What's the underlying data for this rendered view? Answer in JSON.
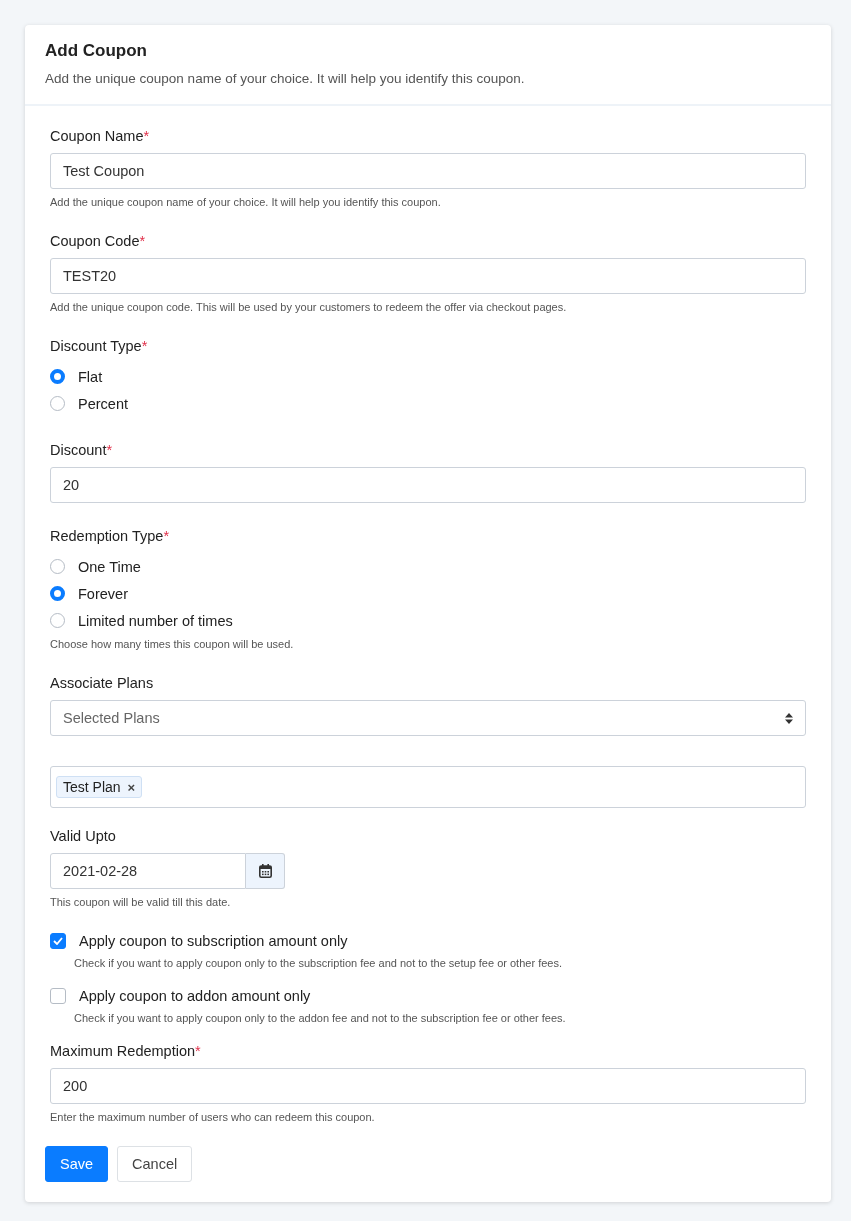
{
  "card": {
    "title": "Add Coupon",
    "subtitle": "Add the unique coupon name of your choice. It will help you identify this coupon."
  },
  "fields": [
    {
      "kind": "text",
      "label": "Coupon Name",
      "required_mark": "*",
      "value": "Test Coupon",
      "help": "Add the unique coupon name of your choice. It will help you identify this coupon."
    },
    {
      "kind": "text",
      "label": "Coupon Code",
      "required_mark": "*",
      "value": "TEST20",
      "help": "Add the unique coupon code. This will be used by your customers to redeem the offer via checkout pages."
    },
    {
      "kind": "radio",
      "label": "Discount Type",
      "required_mark": "*",
      "options": [
        {
          "label": "Flat",
          "selected": true
        },
        {
          "label": "Percent",
          "selected": false
        }
      ]
    },
    {
      "kind": "text",
      "label": "Discount",
      "required_mark": "*",
      "value": "20"
    },
    {
      "kind": "radio",
      "label": "Redemption Type",
      "required_mark": "*",
      "options": [
        {
          "label": "One Time",
          "selected": false
        },
        {
          "label": "Forever",
          "selected": true
        },
        {
          "label": "Limited number of times",
          "selected": false
        }
      ],
      "help": "Choose how many times this coupon will be used."
    },
    {
      "kind": "select",
      "label": "Associate Plans",
      "placeholder": "Selected Plans"
    },
    {
      "kind": "tags",
      "tags": [
        {
          "label": "Test Plan",
          "remove": "×"
        }
      ]
    },
    {
      "kind": "date",
      "label": "Valid Upto",
      "value": "2021-02-28",
      "help": "This coupon will be valid till this date."
    },
    {
      "kind": "checkbox",
      "label": "Apply coupon to subscription amount only",
      "checked": true,
      "help": "Check if you want to apply coupon only to the subscription fee and not to the setup fee or other fees."
    },
    {
      "kind": "checkbox",
      "label": "Apply coupon to addon amount only",
      "checked": false,
      "help": "Check if you want to apply coupon only to the addon fee and not to the subscription fee or other fees."
    },
    {
      "kind": "text",
      "label": "Maximum Redemption",
      "required_mark": "*",
      "value": "200",
      "help": "Enter the maximum number of users who can redeem this coupon."
    }
  ],
  "buttons": [
    {
      "label": "Save",
      "kind": "primary"
    },
    {
      "label": "Cancel",
      "kind": "secondary"
    }
  ]
}
